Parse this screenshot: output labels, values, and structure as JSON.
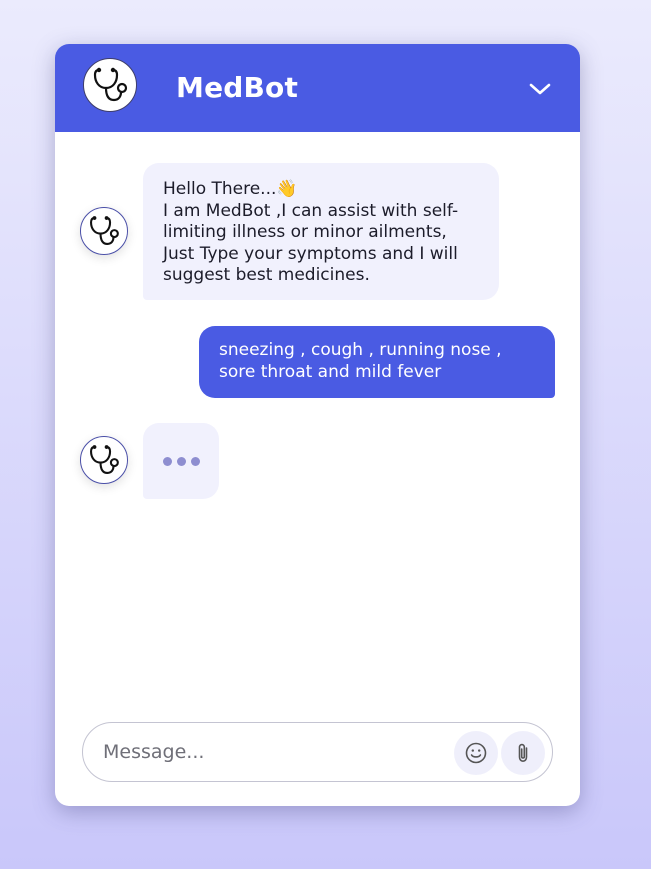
{
  "header": {
    "title": "MedBot",
    "logo_icon": "stethoscope-icon",
    "collapse_icon": "chevron-down-icon"
  },
  "messages": [
    {
      "sender": "bot",
      "lines": [
        "Hello There...👋",
        "I am MedBot ,I can assist with self-",
        "limiting illness or minor ailments,",
        "Just Type your symptoms and I will",
        "suggest best medicines."
      ]
    },
    {
      "sender": "user",
      "lines": [
        "sneezing , cough , running nose ,",
        "sore throat and mild fever"
      ]
    },
    {
      "sender": "bot",
      "typing": true
    }
  ],
  "composer": {
    "placeholder": "Message...",
    "emoji_icon": "smiley-icon",
    "attach_icon": "paperclip-icon"
  },
  "colors": {
    "accent": "#4a5be3",
    "bot_bubble": "#f1f1fd",
    "typing_dot": "#8e8ed0"
  }
}
